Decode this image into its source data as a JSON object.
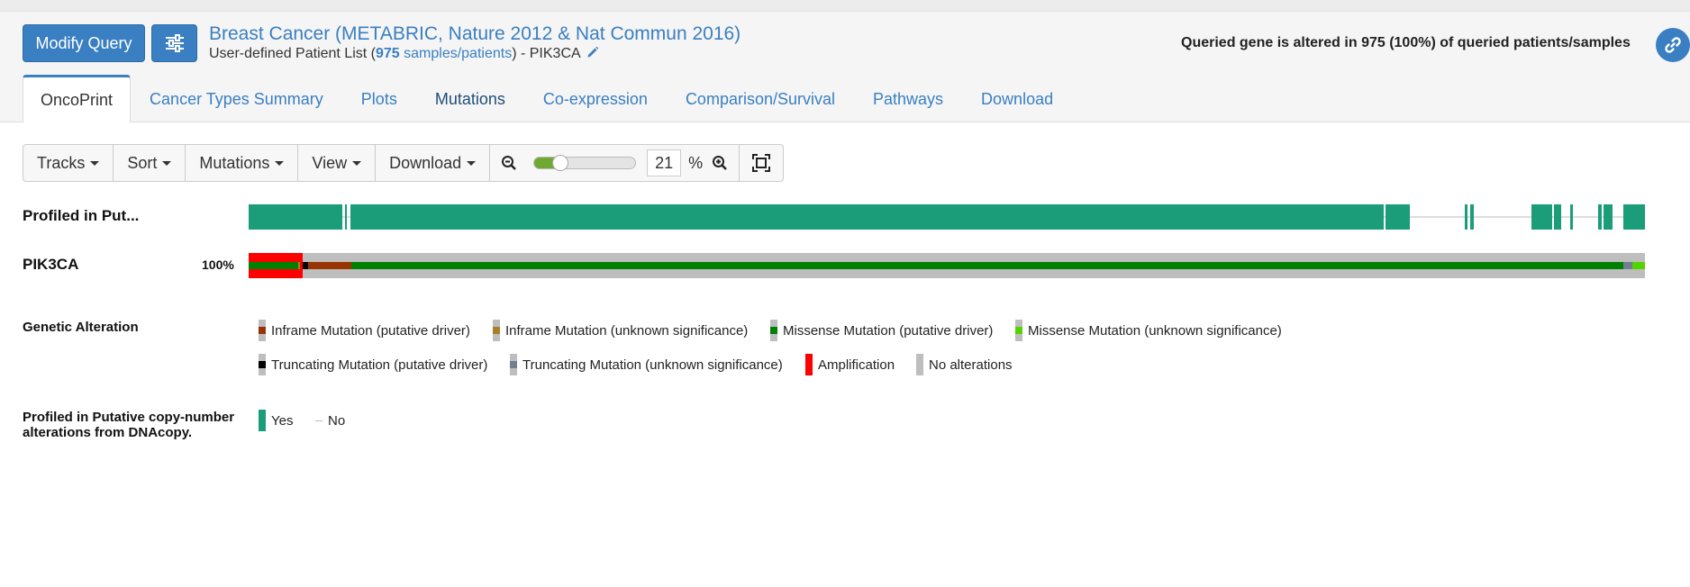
{
  "header": {
    "modify_query_label": "Modify Query",
    "study_title": "Breast Cancer (METABRIC, Nature 2012 & Nat Commun 2016)",
    "subtitle_prefix": "User-defined Patient List (",
    "sample_count": "975",
    "sample_link_text": " samples/patients",
    "subtitle_mid": ")  - ",
    "gene": "PIK3CA",
    "summary_text": "Queried gene is altered in 975 (100%) of queried patients/samples"
  },
  "tabs": [
    {
      "label": "OncoPrint",
      "active": true
    },
    {
      "label": "Cancer Types Summary"
    },
    {
      "label": "Plots"
    },
    {
      "label": "Mutations"
    },
    {
      "label": "Co-expression"
    },
    {
      "label": "Comparison/Survival"
    },
    {
      "label": "Pathways"
    },
    {
      "label": "Download"
    }
  ],
  "toolbar": {
    "tracks": "Tracks",
    "sort": "Sort",
    "mutations": "Mutations",
    "view": "View",
    "download": "Download",
    "zoom_value": "21",
    "zoom_unit": "%",
    "zoom_level": 0.21
  },
  "oncoprint": {
    "profiled_track_label": "Profiled in Put...",
    "gene_track_label": "PIK3CA",
    "gene_altered_pct": "100%"
  },
  "legend": {
    "genetic_title": "Genetic Alteration",
    "items": [
      {
        "label": "Inframe Mutation (putative driver)",
        "color": "#993404"
      },
      {
        "label": "Inframe Mutation (unknown significance)",
        "color": "#a68028"
      },
      {
        "label": "Missense Mutation (putative driver)",
        "color": "#008000"
      },
      {
        "label": "Missense Mutation (unknown significance)",
        "color": "#53d400"
      },
      {
        "label": "Truncating Mutation (putative driver)",
        "color": "#000000"
      },
      {
        "label": "Truncating Mutation (unknown significance)",
        "color": "#708090"
      },
      {
        "label": "Amplification",
        "color": "#ff0000"
      },
      {
        "label": "No alterations",
        "color": "#bebebe"
      }
    ],
    "profiled_title": "Profiled in Putative copy-number alterations from DNAcopy.",
    "yes_label": "Yes",
    "no_label": "No",
    "yes_color": "#1a9d78"
  }
}
